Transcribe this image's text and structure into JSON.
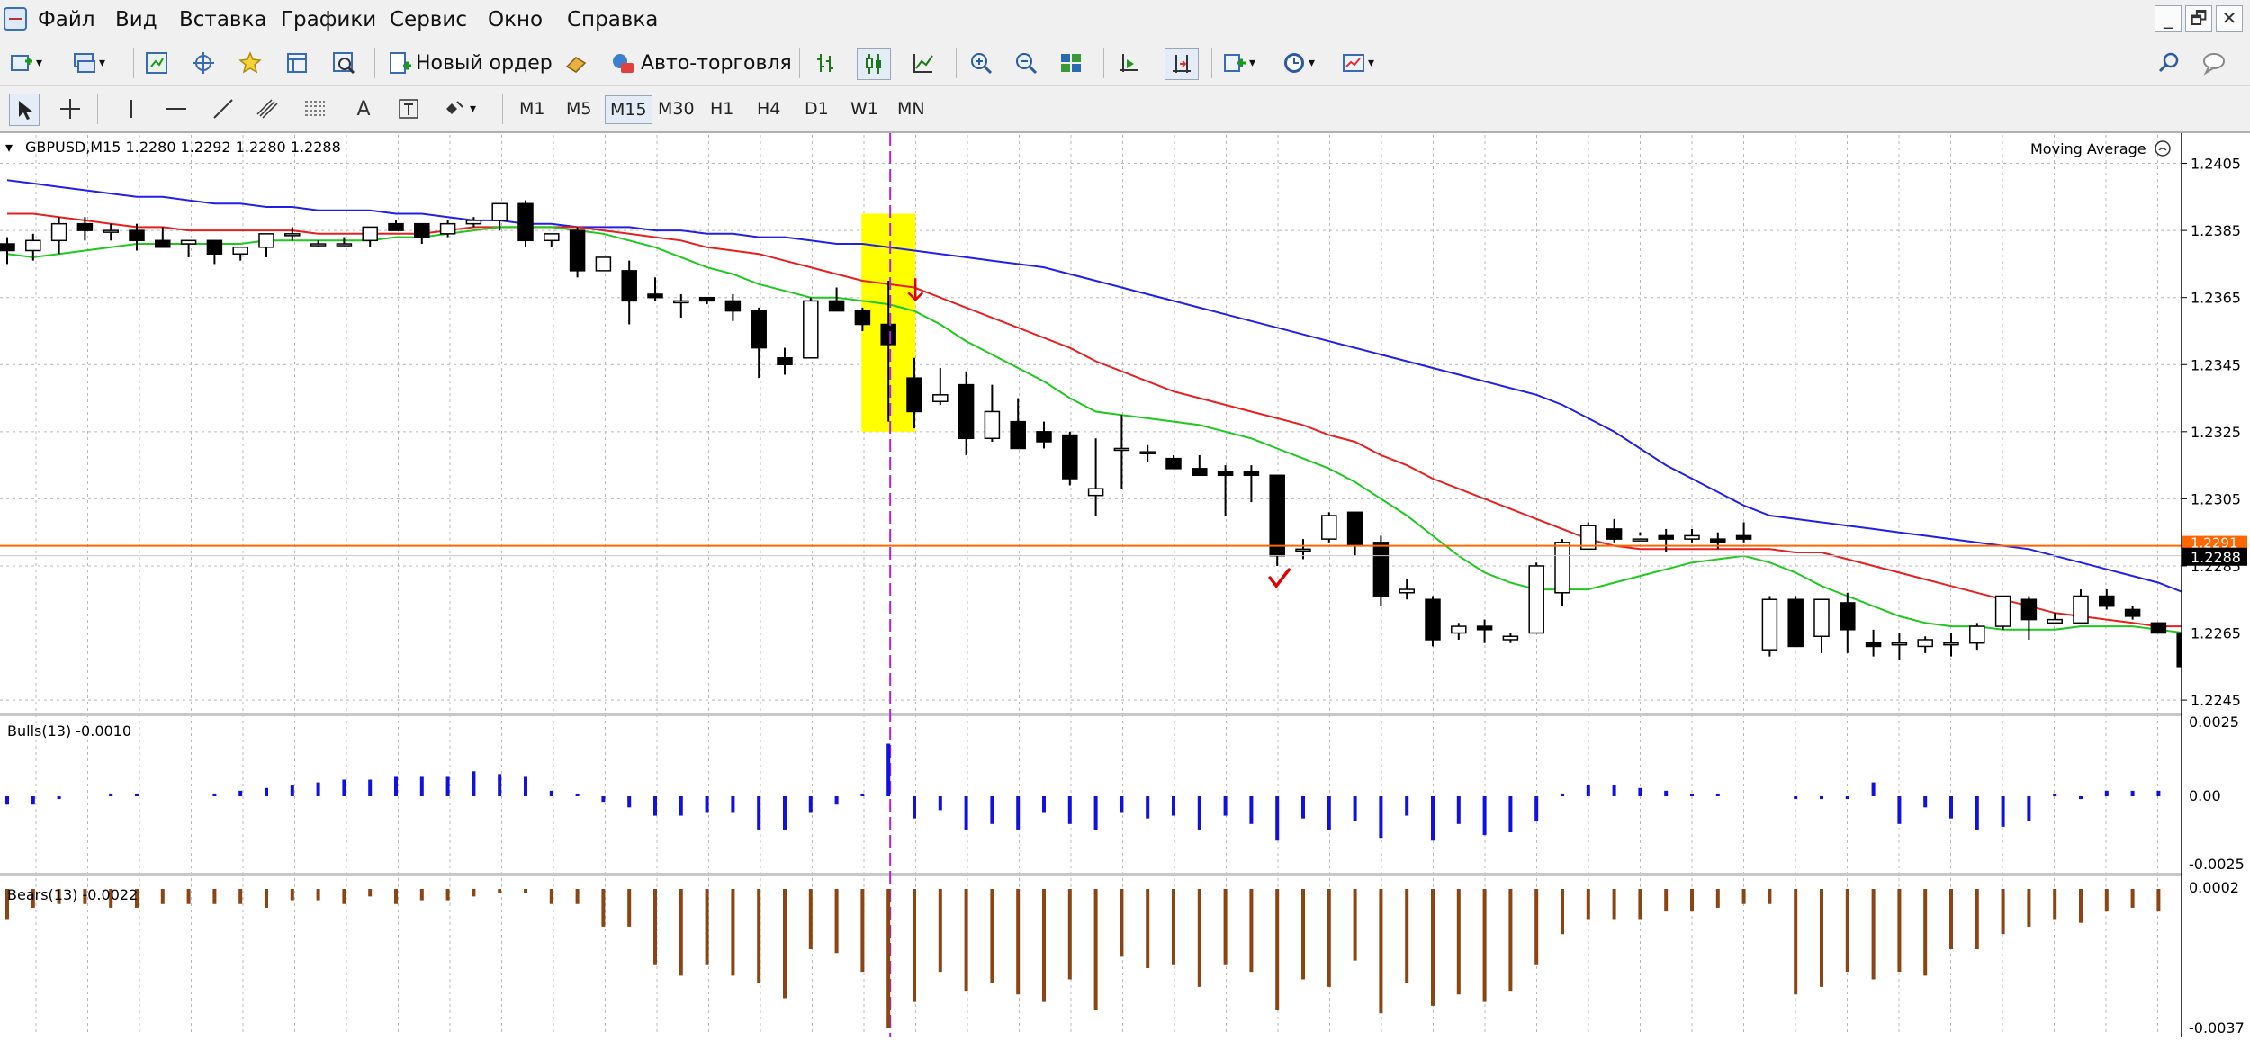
{
  "menu": {
    "items": [
      "Файл",
      "Вид",
      "Вставка",
      "Графики",
      "Сервис",
      "Окно",
      "Справка"
    ],
    "window_buttons": [
      "_",
      "🗗",
      "✕"
    ]
  },
  "toolbar": {
    "new_order_label": "Новый ордер",
    "autotrade_label": "Авто-торговля",
    "icons": [
      "new-chart-icon",
      "profiles-icon",
      "market-watch-icon",
      "navigator-icon",
      "favorites-icon",
      "data-window-icon",
      "strategy-tester-icon",
      "bar-chart-icon",
      "candlestick-icon",
      "line-chart-icon",
      "zoom-in-icon",
      "zoom-out-icon",
      "tile-windows-icon",
      "chart-shift-icon",
      "autoscroll-icon",
      "indicators-icon",
      "periods-icon",
      "templates-icon",
      "search-icon"
    ]
  },
  "drawing_tools": {
    "icons": [
      "cursor-icon",
      "crosshair-icon",
      "vertical-line-icon",
      "horizontal-line-icon",
      "trend-line-icon",
      "equidistant-channel-icon",
      "fibonacci-icon",
      "text-icon",
      "text-label-icon",
      "arrows-icon"
    ],
    "text_tool_label": "A"
  },
  "timeframes": {
    "items": [
      "M1",
      "M5",
      "M15",
      "M30",
      "H1",
      "H4",
      "D1",
      "W1",
      "MN"
    ],
    "active": "M15"
  },
  "chart": {
    "symbol_info": "GBPUSD,M15  1.2280 1.2292 1.2280 1.2288",
    "indicator_label": "Moving Average",
    "price_ticks": [
      "1.2405",
      "1.2385",
      "1.2365",
      "1.2345",
      "1.2325",
      "1.2305",
      "1.2285",
      "1.2265",
      "1.2245"
    ],
    "current_price_label": "1.2288",
    "hline_price_label": "1.2291",
    "colors": {
      "ma_fast": "#1ec81e",
      "ma_mid": "#e62020",
      "ma_slow": "#2020e6",
      "highlight": "#ffff00",
      "bulls": "#1010e0",
      "bears": "#8b4513",
      "hline": "#ff6600",
      "vline": "#b020e0",
      "arrow": "#e00000"
    }
  },
  "bulls_panel": {
    "label": "Bulls(13) -0.0010",
    "ticks": [
      "0.0025",
      "0.00",
      "-0.0025"
    ]
  },
  "bears_panel": {
    "label": "Bears(13) -0.0022",
    "ticks": [
      "0.0002",
      "-0.0037"
    ]
  },
  "chart_data": {
    "type": "candlestick",
    "title": "GBPUSD,M15  1.2280 1.2292 1.2280 1.2288",
    "ylim": [
      1.2241,
      1.2414
    ],
    "candles": [
      [
        1.2381,
        1.2383,
        1.2375,
        1.2379
      ],
      [
        1.2379,
        1.2384,
        1.2376,
        1.2382
      ],
      [
        1.2382,
        1.2389,
        1.2378,
        1.2387
      ],
      [
        1.2387,
        1.2389,
        1.2382,
        1.2385
      ],
      [
        1.2385,
        1.2387,
        1.2382,
        1.2385
      ],
      [
        1.2385,
        1.2387,
        1.2379,
        1.2382
      ],
      [
        1.2382,
        1.2386,
        1.238,
        1.238
      ],
      [
        1.2381,
        1.2382,
        1.2377,
        1.2382
      ],
      [
        1.2382,
        1.2382,
        1.2375,
        1.2378
      ],
      [
        1.2378,
        1.238,
        1.2376,
        1.238
      ],
      [
        1.238,
        1.2384,
        1.2377,
        1.2384
      ],
      [
        1.2384,
        1.2386,
        1.2382,
        1.2384
      ],
      [
        1.2381,
        1.2382,
        1.238,
        1.2381
      ],
      [
        1.2381,
        1.2383,
        1.2381,
        1.2381
      ],
      [
        1.2382,
        1.2386,
        1.238,
        1.2386
      ],
      [
        1.2387,
        1.2388,
        1.2385,
        1.2385
      ],
      [
        1.2387,
        1.2387,
        1.2381,
        1.2383
      ],
      [
        1.2384,
        1.2388,
        1.2383,
        1.2387
      ],
      [
        1.2387,
        1.2389,
        1.2386,
        1.2388
      ],
      [
        1.2388,
        1.2392,
        1.2385,
        1.2393
      ],
      [
        1.2393,
        1.2394,
        1.238,
        1.2382
      ],
      [
        1.2382,
        1.2384,
        1.238,
        1.2384
      ],
      [
        1.2385,
        1.2386,
        1.2371,
        1.2373
      ],
      [
        1.2373,
        1.2377,
        1.2374,
        1.2377
      ],
      [
        1.2373,
        1.2376,
        1.2357,
        1.2364
      ],
      [
        1.2366,
        1.2371,
        1.2364,
        1.2365
      ],
      [
        1.2364,
        1.2366,
        1.2359,
        1.2364
      ],
      [
        1.2365,
        1.2365,
        1.2363,
        1.2364
      ],
      [
        1.2364,
        1.2366,
        1.2358,
        1.2361
      ],
      [
        1.2361,
        1.2362,
        1.2341,
        1.235
      ],
      [
        1.2347,
        1.235,
        1.2342,
        1.2345
      ],
      [
        1.2347,
        1.2365,
        1.2347,
        1.2364
      ],
      [
        1.2364,
        1.2368,
        1.2361,
        1.2361
      ],
      [
        1.2361,
        1.2362,
        1.2355,
        1.2357
      ],
      [
        1.2357,
        1.237,
        1.2328,
        1.2351
      ],
      [
        1.2341,
        1.2347,
        1.2326,
        1.2331
      ],
      [
        1.2334,
        1.2344,
        1.2333,
        1.2336
      ],
      [
        1.2339,
        1.2343,
        1.2318,
        1.2323
      ],
      [
        1.2323,
        1.2339,
        1.2322,
        1.2331
      ],
      [
        1.2328,
        1.2335,
        1.2323,
        1.232
      ],
      [
        1.2325,
        1.2328,
        1.232,
        1.2322
      ],
      [
        1.2324,
        1.2325,
        1.2309,
        1.2311
      ],
      [
        1.2306,
        1.2323,
        1.23,
        1.2308
      ],
      [
        1.232,
        1.233,
        1.2308,
        1.232
      ],
      [
        1.2319,
        1.2321,
        1.2316,
        1.2319
      ],
      [
        1.2317,
        1.2318,
        1.2314,
        1.2314
      ],
      [
        1.2314,
        1.2318,
        1.2312,
        1.2312
      ],
      [
        1.2313,
        1.2315,
        1.23,
        1.2312
      ],
      [
        1.2313,
        1.2315,
        1.2304,
        1.2312
      ],
      [
        1.2312,
        1.2312,
        1.2285,
        1.2288
      ],
      [
        1.229,
        1.2293,
        1.2287,
        1.229
      ],
      [
        1.2293,
        1.2301,
        1.2292,
        1.23
      ],
      [
        1.2301,
        1.2301,
        1.2288,
        1.2291
      ],
      [
        1.2292,
        1.2294,
        1.2273,
        1.2276
      ],
      [
        1.2277,
        1.2281,
        1.2275,
        1.2278
      ],
      [
        1.2275,
        1.2276,
        1.2261,
        1.2263
      ],
      [
        1.2265,
        1.2268,
        1.2263,
        1.2267
      ],
      [
        1.2267,
        1.2269,
        1.2262,
        1.2266
      ],
      [
        1.2263,
        1.2265,
        1.2262,
        1.2264
      ],
      [
        1.2265,
        1.2286,
        1.2265,
        1.2285
      ],
      [
        1.2277,
        1.2293,
        1.2273,
        1.2292
      ],
      [
        1.229,
        1.2298,
        1.2291,
        1.2297
      ],
      [
        1.2296,
        1.2299,
        1.2292,
        1.2293
      ],
      [
        1.2293,
        1.2295,
        1.2294,
        1.2293
      ],
      [
        1.2294,
        1.2296,
        1.2289,
        1.2293
      ],
      [
        1.2293,
        1.2296,
        1.2292,
        1.2294
      ],
      [
        1.2293,
        1.2295,
        1.229,
        1.2292
      ],
      [
        1.2294,
        1.2298,
        1.2292,
        1.2293
      ],
      [
        1.226,
        1.2276,
        1.2258,
        1.2275
      ],
      [
        1.2275,
        1.2276,
        1.2263,
        1.2261
      ],
      [
        1.2264,
        1.2275,
        1.2259,
        1.2275
      ],
      [
        1.2274,
        1.2277,
        1.2259,
        1.2266
      ],
      [
        1.2262,
        1.2266,
        1.2258,
        1.2261
      ],
      [
        1.2262,
        1.2265,
        1.2257,
        1.2262
      ],
      [
        1.2261,
        1.2264,
        1.2259,
        1.2263
      ],
      [
        1.2262,
        1.2265,
        1.2258,
        1.2262
      ],
      [
        1.2262,
        1.2268,
        1.226,
        1.2267
      ],
      [
        1.2267,
        1.2275,
        1.2266,
        1.2276
      ],
      [
        1.2275,
        1.2276,
        1.2263,
        1.2269
      ],
      [
        1.2268,
        1.2271,
        1.2268,
        1.2269
      ],
      [
        1.2268,
        1.2278,
        1.2268,
        1.2276
      ],
      [
        1.2276,
        1.2278,
        1.2272,
        1.2273
      ],
      [
        1.2272,
        1.2273,
        1.2269,
        1.227
      ],
      [
        1.2268,
        1.2268,
        1.2265,
        1.2265
      ],
      [
        1.2265,
        1.2266,
        1.2255,
        1.2255
      ]
    ],
    "ma_fast": [
      1.2378,
      1.2377,
      1.2378,
      1.2379,
      1.238,
      1.2381,
      1.2381,
      1.2381,
      1.2381,
      1.2381,
      1.2382,
      1.2382,
      1.2382,
      1.2382,
      1.2382,
      1.2383,
      1.2383,
      1.2384,
      1.2385,
      1.2386,
      1.2386,
      1.2386,
      1.2385,
      1.2384,
      1.2382,
      1.238,
      1.2377,
      1.2374,
      1.2372,
      1.2369,
      1.2367,
      1.2365,
      1.2365,
      1.2364,
      1.2363,
      1.2361,
      1.2357,
      1.2352,
      1.2348,
      1.2344,
      1.234,
      1.2335,
      1.2331,
      1.233,
      1.2329,
      1.2328,
      1.2327,
      1.2325,
      1.2323,
      1.232,
      1.2317,
      1.2314,
      1.231,
      1.2305,
      1.23,
      1.2294,
      1.2288,
      1.2283,
      1.228,
      1.2278,
      1.2278,
      1.2278,
      1.228,
      1.2282,
      1.2284,
      1.2286,
      1.2287,
      1.2288,
      1.2286,
      1.2283,
      1.2279,
      1.2276,
      1.2273,
      1.227,
      1.2268,
      1.2267,
      1.2267,
      1.2266,
      1.2266,
      1.2266,
      1.2267,
      1.2267,
      1.2267,
      1.2266,
      1.2265
    ],
    "ma_mid": [
      1.239,
      1.239,
      1.2389,
      1.2388,
      1.2387,
      1.2386,
      1.2386,
      1.2385,
      1.2385,
      1.2385,
      1.2385,
      1.2385,
      1.2384,
      1.2384,
      1.2384,
      1.2384,
      1.2384,
      1.2385,
      1.2386,
      1.2386,
      1.2386,
      1.2386,
      1.2386,
      1.2385,
      1.2384,
      1.2383,
      1.2382,
      1.238,
      1.2379,
      1.2378,
      1.2376,
      1.2374,
      1.2372,
      1.237,
      1.2369,
      1.2368,
      1.2365,
      1.2362,
      1.2359,
      1.2356,
      1.2353,
      1.235,
      1.2346,
      1.2343,
      1.234,
      1.2337,
      1.2335,
      1.2333,
      1.2331,
      1.2329,
      1.2327,
      1.2324,
      1.2322,
      1.2318,
      1.2315,
      1.2311,
      1.2308,
      1.2305,
      1.2302,
      1.2299,
      1.2296,
      1.2293,
      1.2291,
      1.229,
      1.229,
      1.229,
      1.229,
      1.229,
      1.229,
      1.2289,
      1.2289,
      1.2287,
      1.2285,
      1.2283,
      1.2281,
      1.2279,
      1.2277,
      1.2275,
      1.2273,
      1.2271,
      1.227,
      1.2269,
      1.2268,
      1.2267,
      1.2267
    ],
    "ma_slow": [
      1.24,
      1.2399,
      1.2398,
      1.2397,
      1.2396,
      1.2395,
      1.2395,
      1.2394,
      1.2393,
      1.2393,
      1.2392,
      1.2392,
      1.2391,
      1.2391,
      1.2391,
      1.239,
      1.239,
      1.2389,
      1.2388,
      1.2388,
      1.2387,
      1.2387,
      1.2386,
      1.2386,
      1.2386,
      1.2385,
      1.2385,
      1.2384,
      1.2384,
      1.2383,
      1.2383,
      1.2382,
      1.2381,
      1.2381,
      1.238,
      1.2379,
      1.2378,
      1.2377,
      1.2376,
      1.2375,
      1.2374,
      1.2372,
      1.237,
      1.2368,
      1.2366,
      1.2364,
      1.2362,
      1.236,
      1.2358,
      1.2356,
      1.2354,
      1.2352,
      1.235,
      1.2348,
      1.2346,
      1.2344,
      1.2342,
      1.234,
      1.2338,
      1.2336,
      1.2333,
      1.2329,
      1.2325,
      1.232,
      1.2315,
      1.2311,
      1.2307,
      1.2303,
      1.23,
      1.2299,
      1.2298,
      1.2297,
      1.2296,
      1.2295,
      1.2294,
      1.2293,
      1.2292,
      1.2291,
      1.229,
      1.2288,
      1.2286,
      1.2284,
      1.2282,
      1.228,
      1.2277
    ],
    "bulls": [
      -0.0003,
      -0.0003,
      -0.0001,
      0.0,
      0.0001,
      0.0001,
      0.0,
      0.0,
      0.0001,
      0.0002,
      0.0003,
      0.0004,
      0.0005,
      0.0006,
      0.0006,
      0.0007,
      0.0007,
      0.0007,
      0.0009,
      0.0008,
      0.0007,
      0.0002,
      0.0001,
      -0.0002,
      -0.0004,
      -0.0007,
      -0.0007,
      -0.0006,
      -0.0006,
      -0.0012,
      -0.0012,
      -0.0006,
      -0.0003,
      0.0001,
      0.0019,
      -0.0008,
      -0.0005,
      -0.0012,
      -0.001,
      -0.0012,
      -0.0006,
      -0.001,
      -0.0012,
      -0.0006,
      -0.0008,
      -0.0007,
      -0.0012,
      -0.0007,
      -0.001,
      -0.0016,
      -0.0008,
      -0.0012,
      -0.0009,
      -0.0015,
      -0.0007,
      -0.0016,
      -0.001,
      -0.0014,
      -0.0013,
      -0.0009,
      0.0001,
      0.0004,
      0.0004,
      0.0003,
      0.0002,
      0.0001,
      0.0001,
      0.0,
      0.0,
      -0.0001,
      -0.0001,
      -0.0001,
      0.0005,
      -0.001,
      -0.0004,
      -0.0008,
      -0.0012,
      -0.0011,
      -0.0009,
      0.0001,
      -0.0001,
      0.0002,
      0.0002,
      0.0002,
      0.0004,
      0.0002,
      0.0002,
      -0.0001,
      -0.001
    ],
    "bears": [
      -0.0008,
      -0.0005,
      -0.0004,
      -0.0004,
      -0.0005,
      -0.0005,
      -0.0004,
      -0.0004,
      -0.0004,
      -0.0004,
      -0.0005,
      -0.0003,
      -0.0003,
      -0.0004,
      -0.0002,
      -0.0004,
      -0.0003,
      -0.0003,
      -0.0002,
      -0.0001,
      -0.0001,
      -0.0004,
      -0.0004,
      -0.001,
      -0.001,
      -0.002,
      -0.0023,
      -0.002,
      -0.0023,
      -0.0025,
      -0.0029,
      -0.0016,
      -0.0017,
      -0.0022,
      -0.0037,
      -0.003,
      -0.0022,
      -0.0027,
      -0.0025,
      -0.0028,
      -0.003,
      -0.0024,
      -0.0032,
      -0.0018,
      -0.0021,
      -0.002,
      -0.0026,
      -0.002,
      -0.0022,
      -0.0032,
      -0.0024,
      -0.0026,
      -0.0019,
      -0.0033,
      -0.0025,
      -0.0031,
      -0.0028,
      -0.003,
      -0.0027,
      -0.002,
      -0.0012,
      -0.0008,
      -0.0008,
      -0.0008,
      -0.0006,
      -0.0006,
      -0.0005,
      -0.0004,
      -0.0004,
      -0.0028,
      -0.0026,
      -0.0022,
      -0.0024,
      -0.0022,
      -0.0023,
      -0.0016,
      -0.0016,
      -0.0012,
      -0.001,
      -0.0008,
      -0.0009,
      -0.0006,
      -0.0005,
      -0.0006,
      -0.0008
    ]
  }
}
